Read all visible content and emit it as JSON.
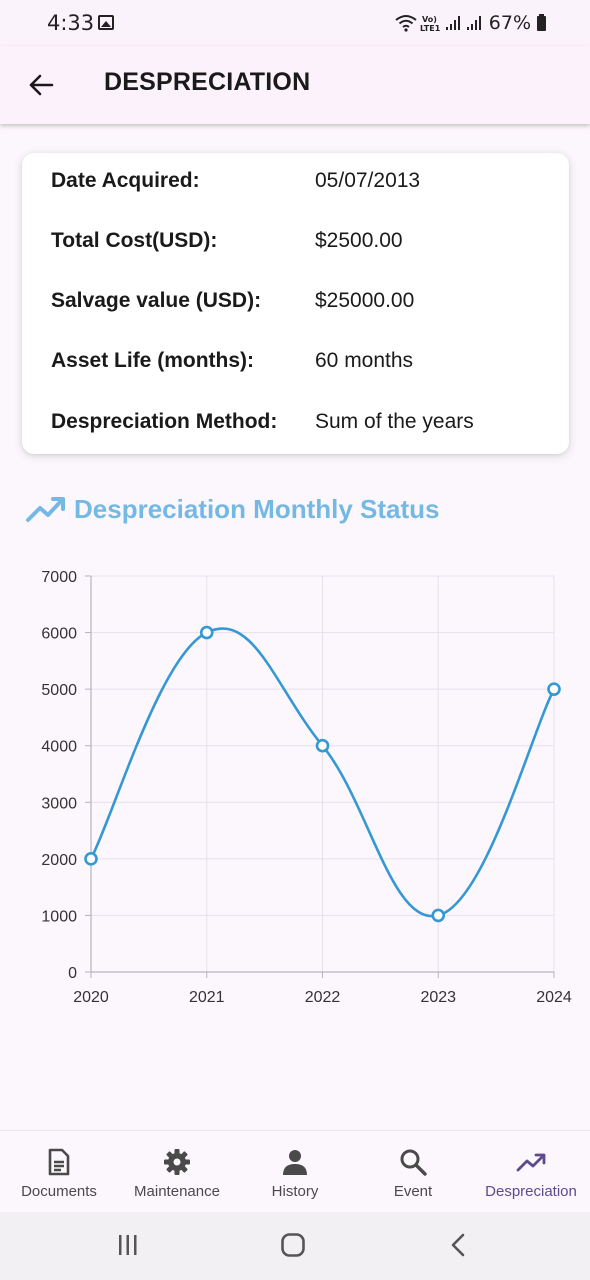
{
  "status_bar": {
    "time": "4:33",
    "battery": "67%",
    "network": "Vo) LTE1"
  },
  "app_bar": {
    "title": "DESPRECIATION",
    "back_icon": "arrow-left-icon"
  },
  "asset_info": [
    {
      "label": "Date Acquired:",
      "value": "05/07/2013"
    },
    {
      "label": "Total Cost(USD):",
      "value": "$2500.00"
    },
    {
      "label": "Salvage value (USD):",
      "value": "$25000.00"
    },
    {
      "label": "Asset Life (months):",
      "value": "60 months"
    },
    {
      "label": "Despreciation Method:",
      "value": "Sum of the years"
    }
  ],
  "section": {
    "title": "Despreciation Monthly Status",
    "icon": "trending-up-icon",
    "color": "#74b9e4"
  },
  "chart_data": {
    "type": "line",
    "x": [
      "2020",
      "2021",
      "2022",
      "2023",
      "2024"
    ],
    "series": [
      {
        "values": [
          2000,
          6000,
          4000,
          1000,
          5000
        ],
        "color": "#3597d3"
      }
    ],
    "ylim": [
      0,
      7000
    ],
    "yticks": [
      "0",
      "1000",
      "2000",
      "3000",
      "4000",
      "5000",
      "6000",
      "7000"
    ],
    "grid": true,
    "curved": true
  },
  "bottom_nav": [
    {
      "label": "Documents",
      "icon": "document-icon",
      "active": false
    },
    {
      "label": "Maintenance",
      "icon": "gear-icon",
      "active": false
    },
    {
      "label": "History",
      "icon": "person-icon",
      "active": false
    },
    {
      "label": "Event",
      "icon": "search-icon",
      "active": false
    },
    {
      "label": "Despreciation",
      "icon": "trending-up-icon",
      "active": true
    }
  ],
  "colors": {
    "accent": "#5e4a8f",
    "line": "#3597d3",
    "heading": "#74b9e4"
  }
}
